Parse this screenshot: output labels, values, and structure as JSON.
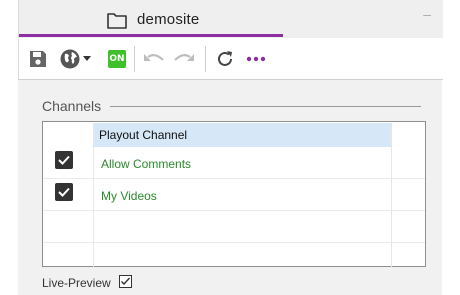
{
  "tab": {
    "title": "demosite",
    "minimize": "–"
  },
  "toolbar": {
    "icons": [
      "save-icon",
      "globe-icon",
      "dropdown-icon",
      "on-badge",
      "undo-icon",
      "redo-icon",
      "refresh-icon",
      "more-icon"
    ],
    "on_label": "ON"
  },
  "channels": {
    "title": "Channels",
    "header": "Playout Channel",
    "rows": [
      {
        "label": "Allow Comments",
        "checked": true
      },
      {
        "label": "My Videos",
        "checked": true
      }
    ]
  },
  "live_preview": {
    "label": "Live-Preview",
    "checked": true
  },
  "colors": {
    "accent": "#8b2fa3",
    "on_green": "#3fbf2a",
    "row_text": "#2a8a2a",
    "header_bg": "#d6e7f7"
  }
}
